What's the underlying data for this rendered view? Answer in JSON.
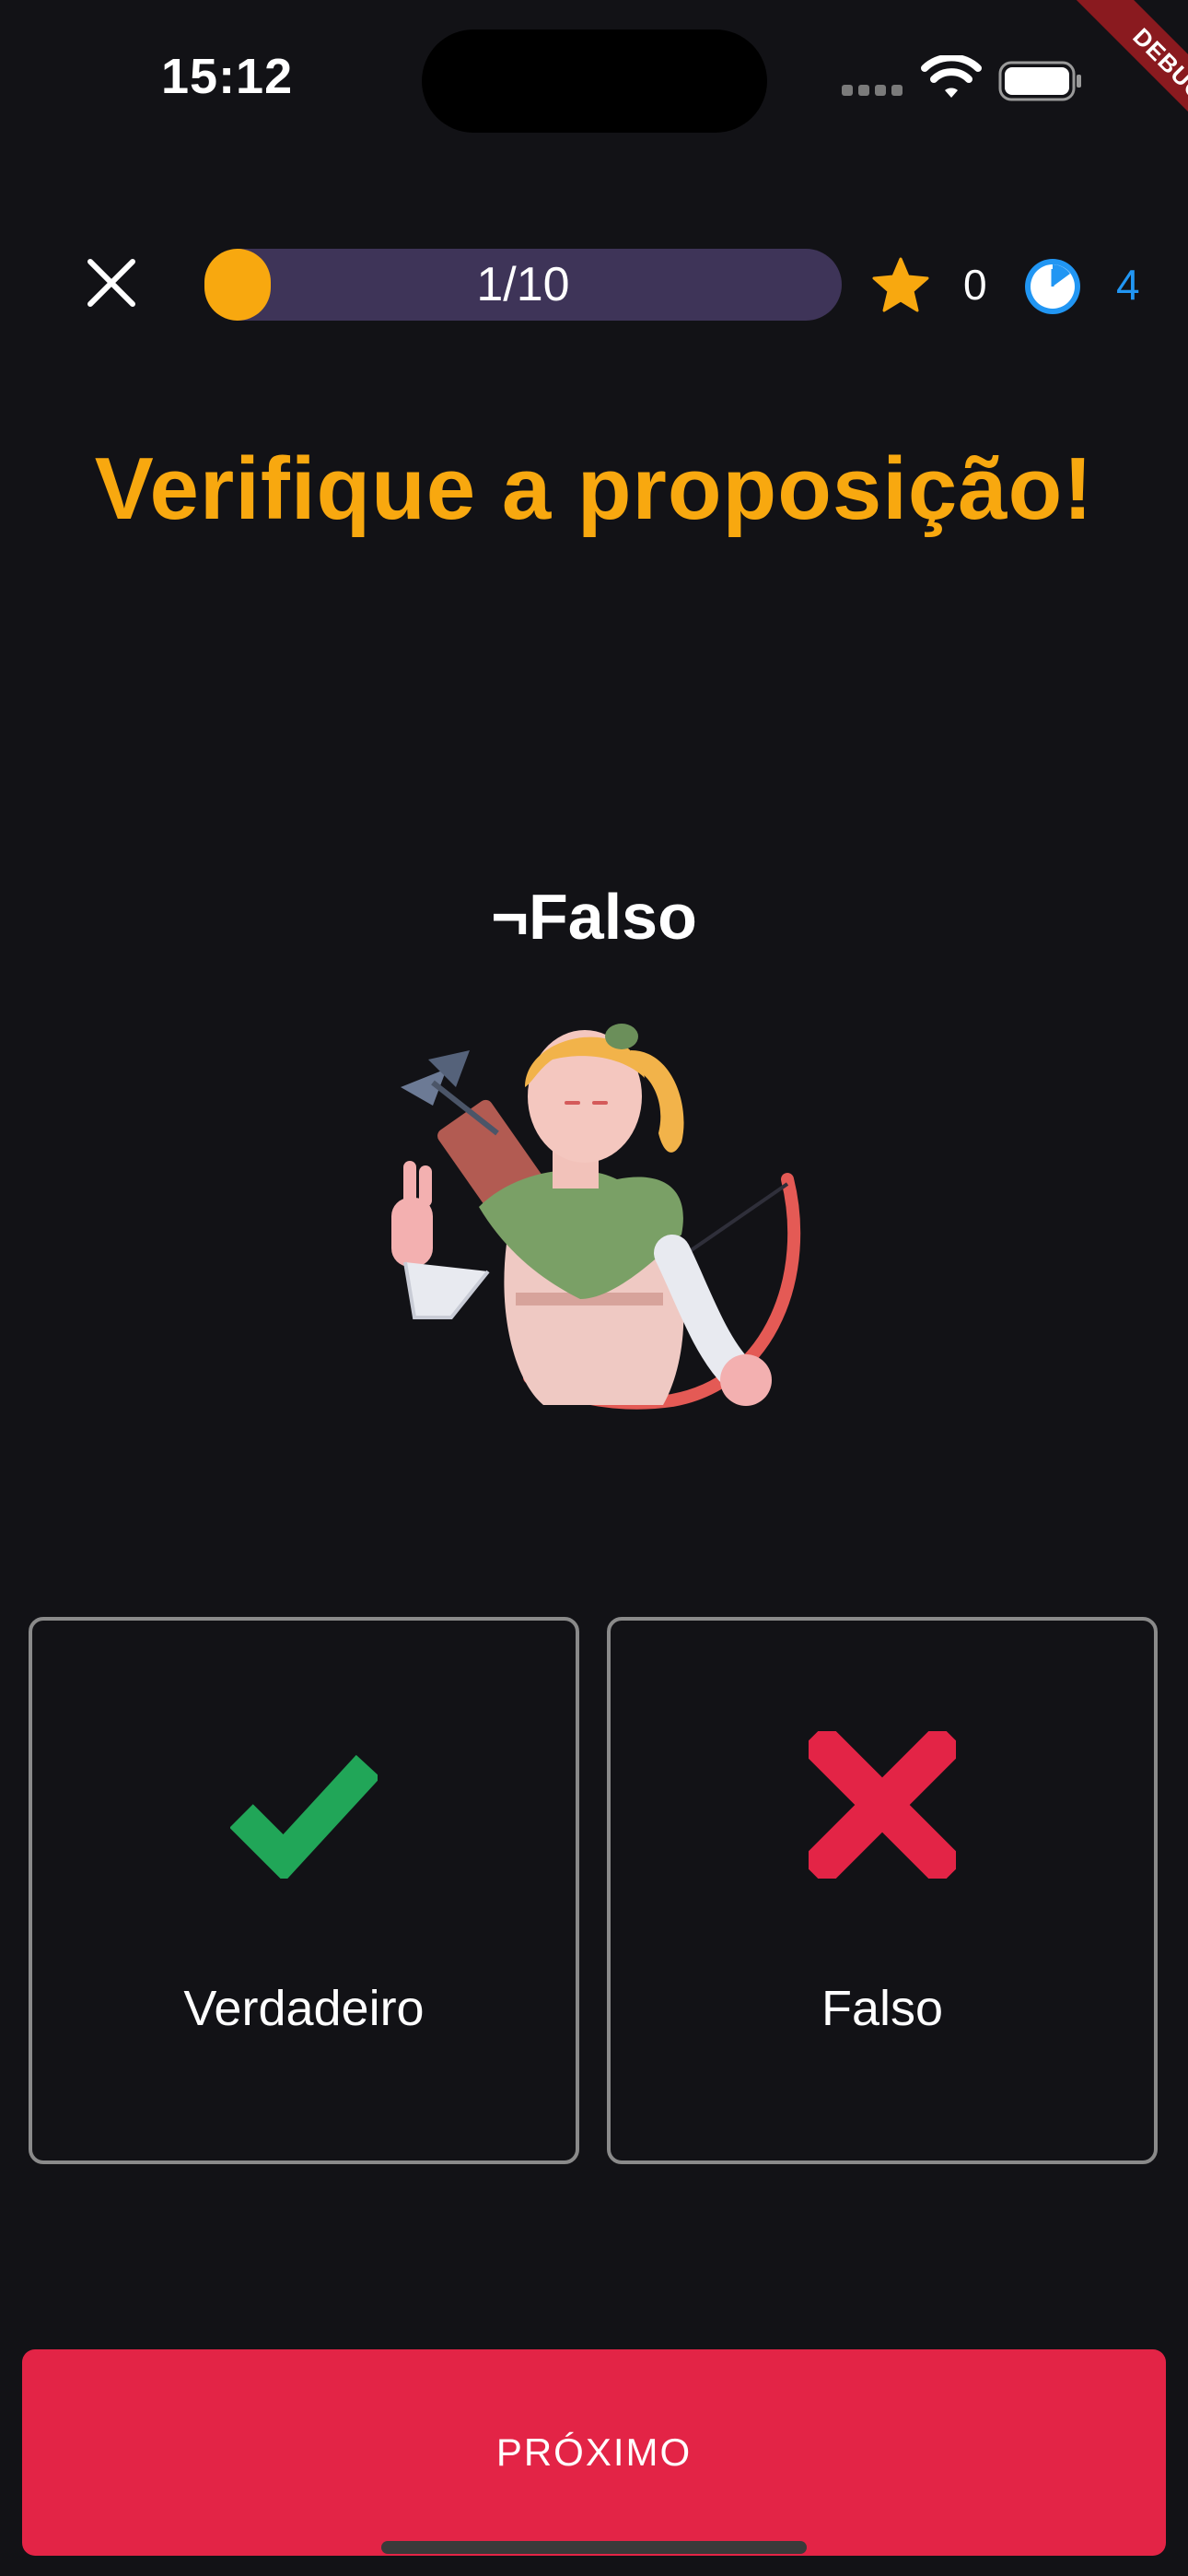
{
  "status_bar": {
    "time": "15:12"
  },
  "debug_banner": {
    "label": "DEBUG"
  },
  "top_bar": {
    "progress_label": "1/10",
    "progress_fraction": 0.1,
    "stars": "0",
    "time_remaining": "4"
  },
  "quiz": {
    "title": "Verifique a proposição!",
    "proposition": "¬Falso"
  },
  "answers": [
    {
      "label": "Verdadeiro",
      "icon": "check-icon",
      "color": "#21a658"
    },
    {
      "label": "Falso",
      "icon": "cross-icon",
      "color": "#e32446"
    }
  ],
  "next_button": {
    "label": "PRÓXIMO"
  },
  "colors": {
    "background": "#121216",
    "accent": "#f8a80f",
    "progress_track": "#3e3458",
    "timer": "#2196f3",
    "next": "#e32446"
  }
}
